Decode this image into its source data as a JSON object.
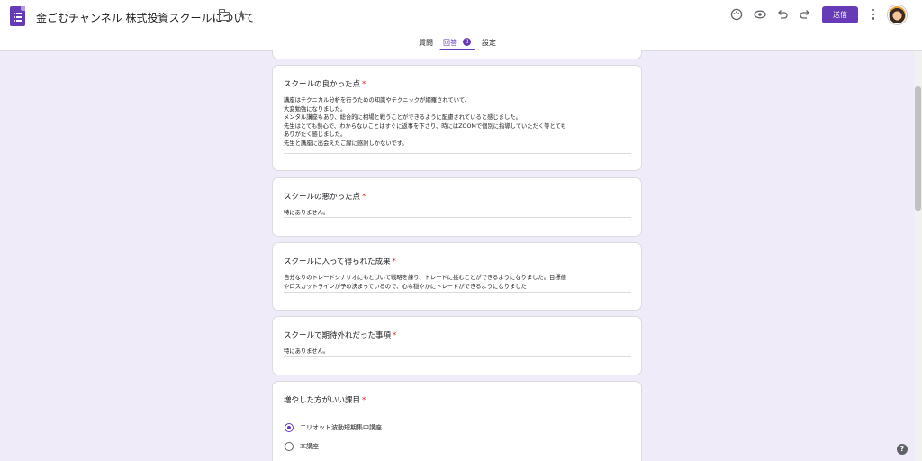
{
  "header": {
    "title": "金ごむチャンネル 株式投資スクールについて",
    "send_label": "送信",
    "icons": [
      "forms-logo-icon",
      "folder-icon",
      "star-icon",
      "palette-icon",
      "eye-icon",
      "undo-icon",
      "redo-icon",
      "more-vert-icon",
      "avatar"
    ]
  },
  "tabs": {
    "questions": "質問",
    "responses": "回答",
    "responses_count": "3",
    "settings": "設定"
  },
  "questions": [
    {
      "label": "スクールの良かった点",
      "required_mark": "*",
      "answer": "講座はテクニカル分析を行うための知識やテクニックが網羅されていて、\n大変勉強になりました。\nメンタル講座もあり、総合的に相場と戦うことができるように配慮されていると感じました。\n先生はとても熱心で、わからないことはすぐに返事を下さり、時にはZOOMで個別に指導していただく等とても\nありがたく感じました。\n先生と講座に出会えたご縁に感謝しかないです。"
    },
    {
      "label": "スクールの悪かった点",
      "required_mark": "*",
      "answer": "特にありません。"
    },
    {
      "label": "スクールに入って得られた成果",
      "required_mark": "*",
      "answer": "自分なりのトレードシナリオにもとづいて戦略を練り、トレードに挑むことができるようになりました。目標値\nやロスカットラインが予め決まっているので、心も穏やかにトレードができるようになりました"
    },
    {
      "label": "スクールで期待外れだった事項",
      "required_mark": "*",
      "answer": "特にありません。"
    },
    {
      "label": "増やした方がいい課目",
      "required_mark": "*",
      "options": [
        {
          "label": "エリオット波動短期集中講座",
          "selected": true
        },
        {
          "label": "本講座",
          "selected": false
        }
      ]
    }
  ],
  "colors": {
    "accent": "#673ab7",
    "background": "#f0ebf8",
    "required": "#d93025"
  }
}
